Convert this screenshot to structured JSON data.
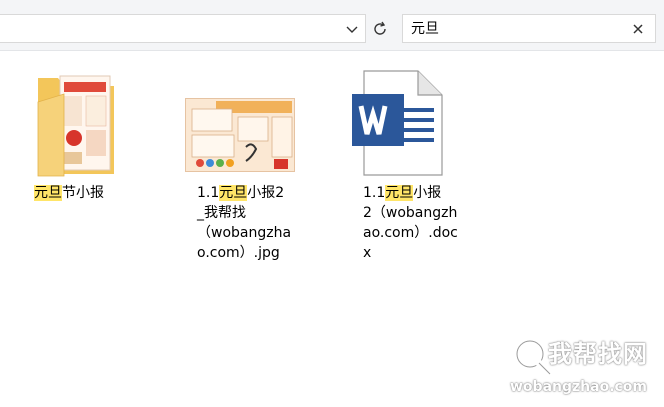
{
  "search": {
    "value": "元旦"
  },
  "files": [
    {
      "name_lines": [
        {
          "pre": "",
          "hl": "元旦",
          "post": "节小报"
        }
      ],
      "icon": "folder-icon"
    },
    {
      "name_lines": [
        {
          "pre": "1.1",
          "hl": "元旦",
          "post": "小报2"
        },
        {
          "pre": "_我帮找",
          "hl": "",
          "post": ""
        },
        {
          "pre": "（wobangzha",
          "hl": "",
          "post": ""
        },
        {
          "pre": "o.com）.jpg",
          "hl": "",
          "post": ""
        }
      ],
      "icon": "image-thumbnail"
    },
    {
      "name_lines": [
        {
          "pre": "1.1",
          "hl": "元旦",
          "post": "小报"
        },
        {
          "pre": "2（wobangzh",
          "hl": "",
          "post": ""
        },
        {
          "pre": "ao.com）.doc",
          "hl": "",
          "post": ""
        },
        {
          "pre": "x",
          "hl": "",
          "post": ""
        }
      ],
      "icon": "word-document-icon"
    }
  ],
  "watermark": {
    "title": "我帮找网",
    "domain": "wobangzhao.com"
  },
  "colors": {
    "highlight": "#ffe568",
    "word_blue": "#2b579a"
  }
}
